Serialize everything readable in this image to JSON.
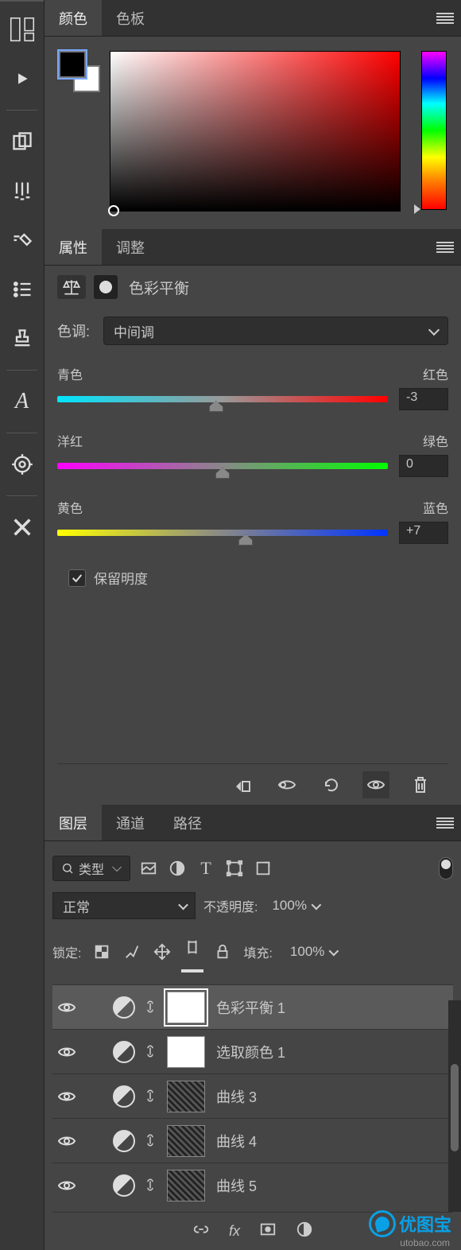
{
  "toolbar_icons": [
    "panels",
    "play",
    "cards",
    "brushes",
    "brush2",
    "list",
    "stamp",
    "font",
    "target",
    "crossbrush"
  ],
  "color_panel": {
    "tabs": {
      "color": "颜色",
      "swatches": "色板"
    },
    "foreground": "#000000",
    "background": "#ffffff",
    "hue": "red"
  },
  "props_panel": {
    "tabs": {
      "props": "属性",
      "adjust": "调整"
    },
    "adjustment_name": "色彩平衡",
    "tone_label": "色调:",
    "tone_value": "中间调",
    "sliders": {
      "cyan_red": {
        "left": "青色",
        "right": "红色",
        "value": "-3",
        "pos": 48
      },
      "magenta_green": {
        "left": "洋红",
        "right": "绿色",
        "value": "0",
        "pos": 50
      },
      "yellow_blue": {
        "left": "黄色",
        "right": "蓝色",
        "value": "+7",
        "pos": 57
      }
    },
    "preserve_label": "保留明度",
    "preserve_checked": true
  },
  "layers_panel": {
    "tabs": {
      "layers": "图层",
      "channels": "通道",
      "paths": "路径"
    },
    "filter_label": "类型",
    "blend_mode": "正常",
    "opacity_label": "不透明度:",
    "opacity_value": "100%",
    "lock_label": "锁定:",
    "fill_label": "填充:",
    "fill_value": "100%",
    "layers": [
      {
        "name": "色彩平衡 1",
        "thumb": "white",
        "selected": true
      },
      {
        "name": "选取颜色 1",
        "thumb": "white",
        "selected": false
      },
      {
        "name": "曲线 3",
        "thumb": "img",
        "selected": false
      },
      {
        "name": "曲线 4",
        "thumb": "img",
        "selected": false
      },
      {
        "name": "曲线 5",
        "thumb": "img",
        "selected": false
      }
    ],
    "footer_fx": "fx"
  },
  "watermark": {
    "brand": "优图宝",
    "url": "utobao.com"
  }
}
